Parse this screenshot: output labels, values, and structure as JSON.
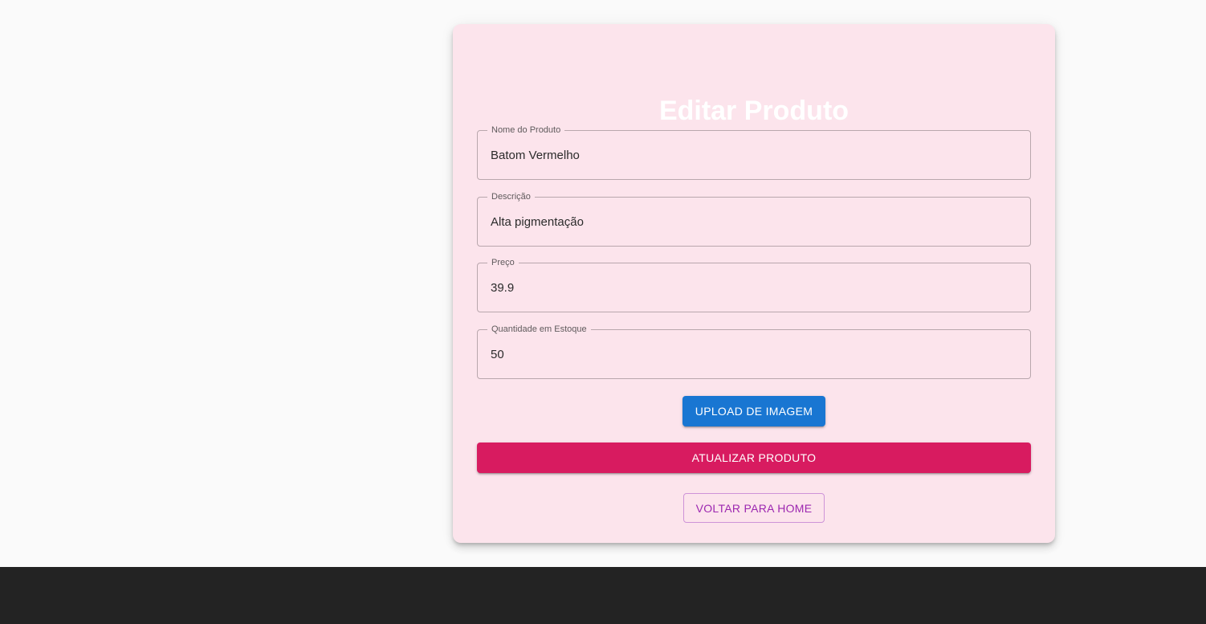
{
  "form": {
    "title": "Editar Produto",
    "fields": [
      {
        "label": "Nome do Produto",
        "value": "Batom Vermelho"
      },
      {
        "label": "Descrição",
        "value": "Alta pigmentação"
      },
      {
        "label": "Preço",
        "value": "39.9"
      },
      {
        "label": "Quantidade em Estoque",
        "value": "50"
      }
    ],
    "upload_label": "UPLOAD DE IMAGEM",
    "update_label": "ATUALIZAR PRODUTO",
    "home_label": "VOLTAR PARA HOME"
  },
  "colors": {
    "card_background": "#fce4ec",
    "upload_button": "#1976d2",
    "update_button": "#d81b60",
    "home_button_text": "#9c27b0",
    "footer": "#232323"
  }
}
